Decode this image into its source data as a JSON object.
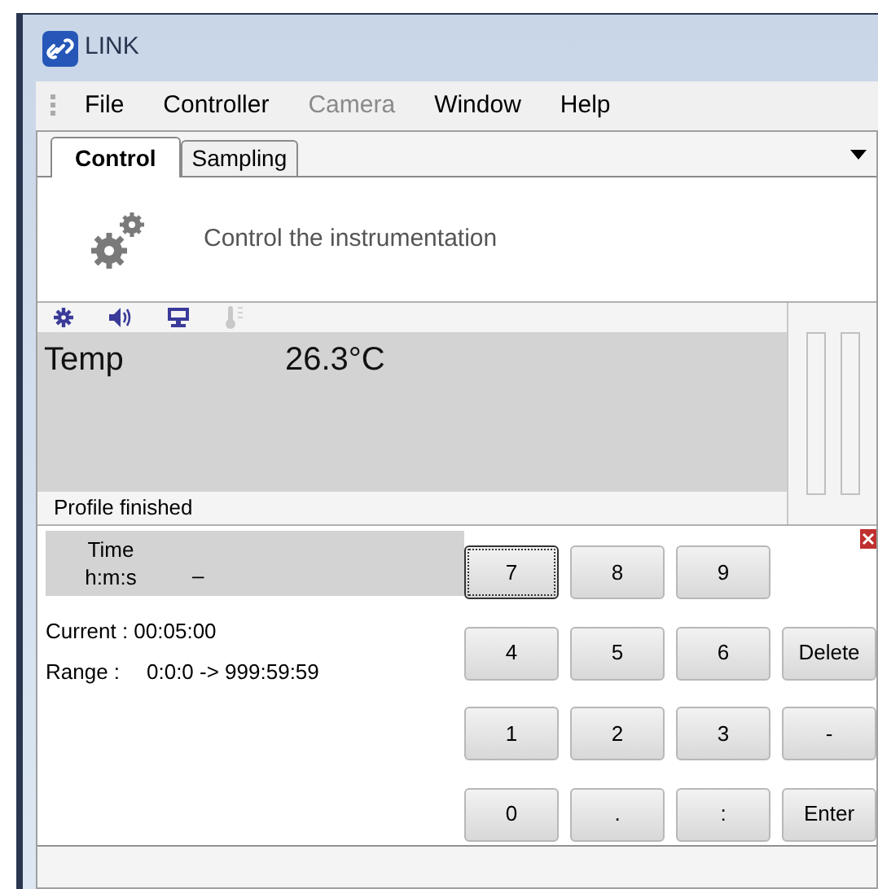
{
  "window": {
    "title": "LINK"
  },
  "menu": [
    {
      "label": "File",
      "disabled": false
    },
    {
      "label": "Controller",
      "disabled": false
    },
    {
      "label": "Camera",
      "disabled": true
    },
    {
      "label": "Window",
      "disabled": false
    },
    {
      "label": "Help",
      "disabled": false
    }
  ],
  "tabs": [
    {
      "label": "Control",
      "selected": true
    },
    {
      "label": "Sampling",
      "selected": false
    }
  ],
  "header": {
    "text": "Control the instrumentation"
  },
  "readout": {
    "label": "Temp",
    "value": "26.3°C",
    "status": "Profile finished"
  },
  "time_display": {
    "label": "Time",
    "unit": "h:m:s",
    "value": "–"
  },
  "current": "Current : 00:05:00",
  "range": {
    "label": "Range :",
    "value": "0:0:0 -> 999:59:59"
  },
  "keypad": [
    {
      "label": "7",
      "focused": true
    },
    {
      "label": "8",
      "focused": false
    },
    {
      "label": "9",
      "focused": false
    },
    {
      "label": "4",
      "focused": false
    },
    {
      "label": "5",
      "focused": false
    },
    {
      "label": "6",
      "focused": false
    },
    {
      "label": "Delete",
      "focused": false
    },
    {
      "label": "1",
      "focused": false
    },
    {
      "label": "2",
      "focused": false
    },
    {
      "label": "3",
      "focused": false
    },
    {
      "label": "-",
      "focused": false
    },
    {
      "label": "0",
      "focused": false
    },
    {
      "label": ".",
      "focused": false
    },
    {
      "label": ":",
      "focused": false
    },
    {
      "label": "Enter",
      "focused": false
    }
  ]
}
